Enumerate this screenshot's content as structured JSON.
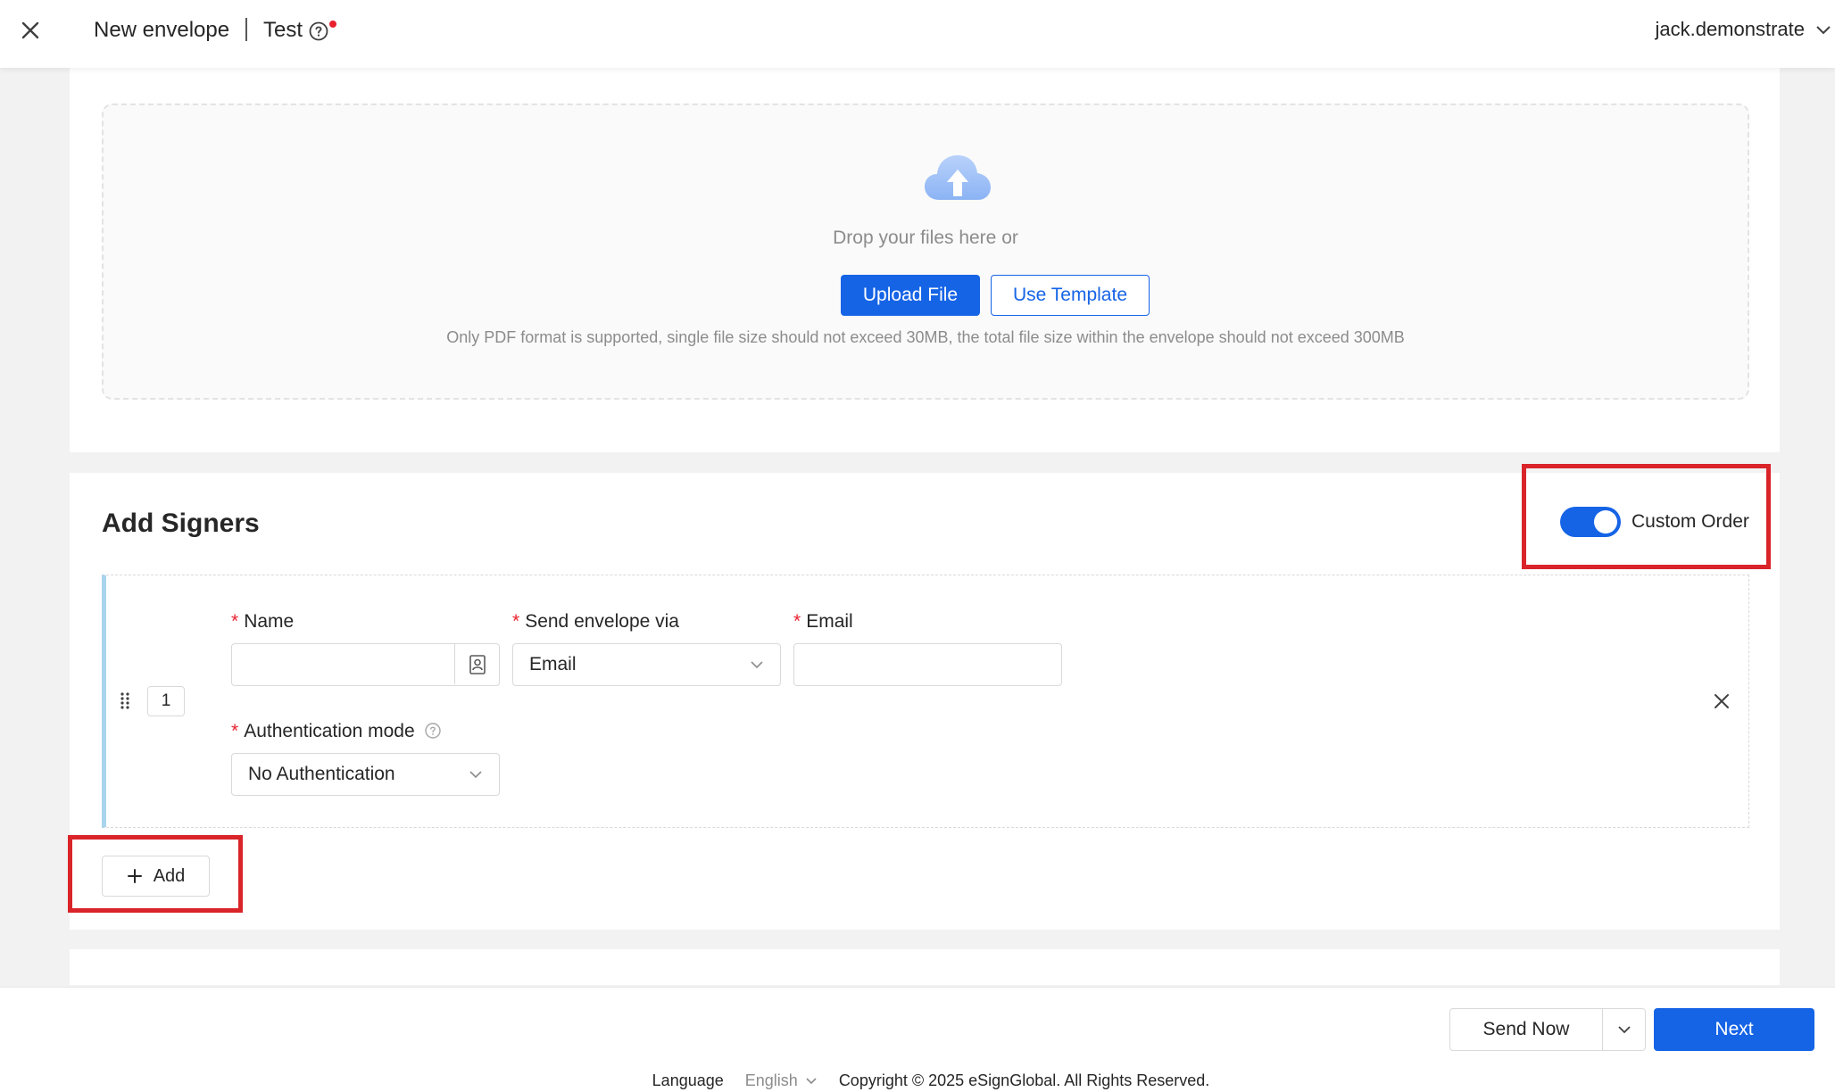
{
  "header": {
    "title": "New envelope",
    "envelope_name": "Test",
    "user": "jack.demonstrate"
  },
  "upload": {
    "drop_text": "Drop your files here or",
    "upload_label": "Upload File",
    "template_label": "Use Template",
    "note": "Only PDF format is supported, single file size should not exceed 30MB, the total file size within the envelope should not exceed 300MB"
  },
  "signers": {
    "title": "Add Signers",
    "custom_order_label": "Custom Order",
    "custom_order_enabled": true,
    "rows": [
      {
        "order": "1",
        "name_label": "Name",
        "name_value": "",
        "via_label": "Send envelope via",
        "via_value": "Email",
        "email_label": "Email",
        "email_value": "",
        "auth_label": "Authentication mode",
        "auth_value": "No Authentication"
      }
    ],
    "add_label": "Add"
  },
  "actions": {
    "send_now_label": "Send Now",
    "next_label": "Next"
  },
  "footer": {
    "language_label": "Language",
    "language_value": "English",
    "copyright": "Copyright © 2025 eSignGlobal. All Rights Reserved."
  },
  "colors": {
    "primary": "#1664e6",
    "highlight": "#d9242a",
    "required": "#e8212e",
    "row_accent": "#a8d4ee"
  }
}
